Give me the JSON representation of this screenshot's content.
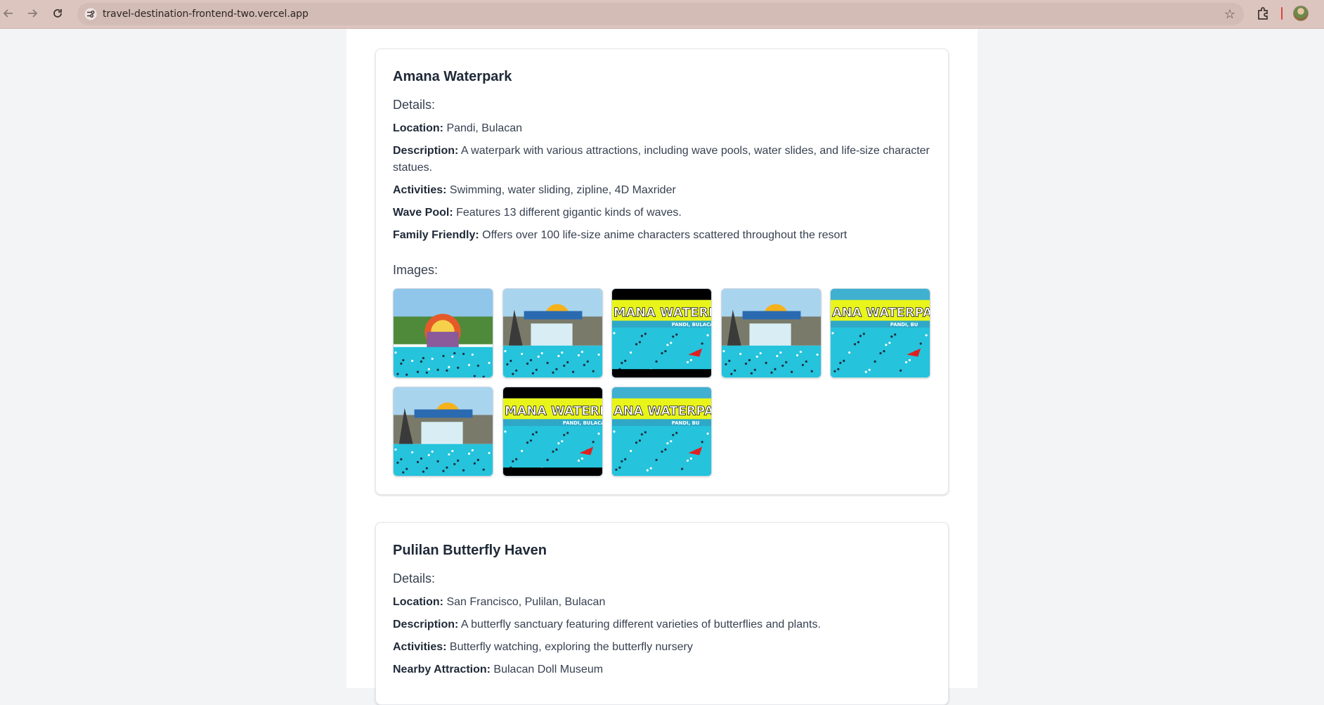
{
  "browser": {
    "url": "travel-destination-frontend-two.vercel.app",
    "icons": [
      "back-icon",
      "forward-icon",
      "reload-icon",
      "site-settings-icon",
      "bookmark-star-icon",
      "extensions-icon",
      "profile-avatar"
    ]
  },
  "destinations": [
    {
      "title": "Amana Waterpark",
      "details_heading": "Details:",
      "fields": [
        {
          "label": "Location:",
          "value": " Pandi, Bulacan"
        },
        {
          "label": "Description:",
          "value": " A waterpark with various attractions, including wave pools, water slides, and life-size character statues."
        },
        {
          "label": "Activities:",
          "value": " Swimming, water sliding, zipline, 4D Maxrider"
        },
        {
          "label": "Wave Pool:",
          "value": " Features 13 different gigantic kinds of waves."
        },
        {
          "label": "Family Friendly:",
          "value": " Offers over 100 life-size anime characters scattered throughout the resort"
        }
      ],
      "images_heading": "Images:",
      "images": [
        {
          "variant": "arch",
          "caption": ""
        },
        {
          "variant": "falls",
          "caption": ""
        },
        {
          "variant": "banner-black",
          "caption": "MANA WATERPAR",
          "sub": "PANDI, BULACA"
        },
        {
          "variant": "falls",
          "caption": ""
        },
        {
          "variant": "banner",
          "caption": "ANA WATERPA",
          "sub": "PANDI, BU"
        },
        {
          "variant": "falls",
          "caption": ""
        },
        {
          "variant": "banner-black",
          "caption": "MANA WATERPAR",
          "sub": "PANDI, BULACA"
        },
        {
          "variant": "banner",
          "caption": "ANA WATERPA",
          "sub": "PANDI, BU"
        }
      ]
    },
    {
      "title": "Pulilan Butterfly Haven",
      "details_heading": "Details:",
      "fields": [
        {
          "label": "Location:",
          "value": " San Francisco, Pulilan, Bulacan"
        },
        {
          "label": "Description:",
          "value": " A butterfly sanctuary featuring different varieties of butterflies and plants."
        },
        {
          "label": "Activities:",
          "value": " Butterfly watching, exploring the butterfly nursery"
        },
        {
          "label": "Nearby Attraction:",
          "value": " Bulacan Doll Museum"
        }
      ]
    }
  ]
}
